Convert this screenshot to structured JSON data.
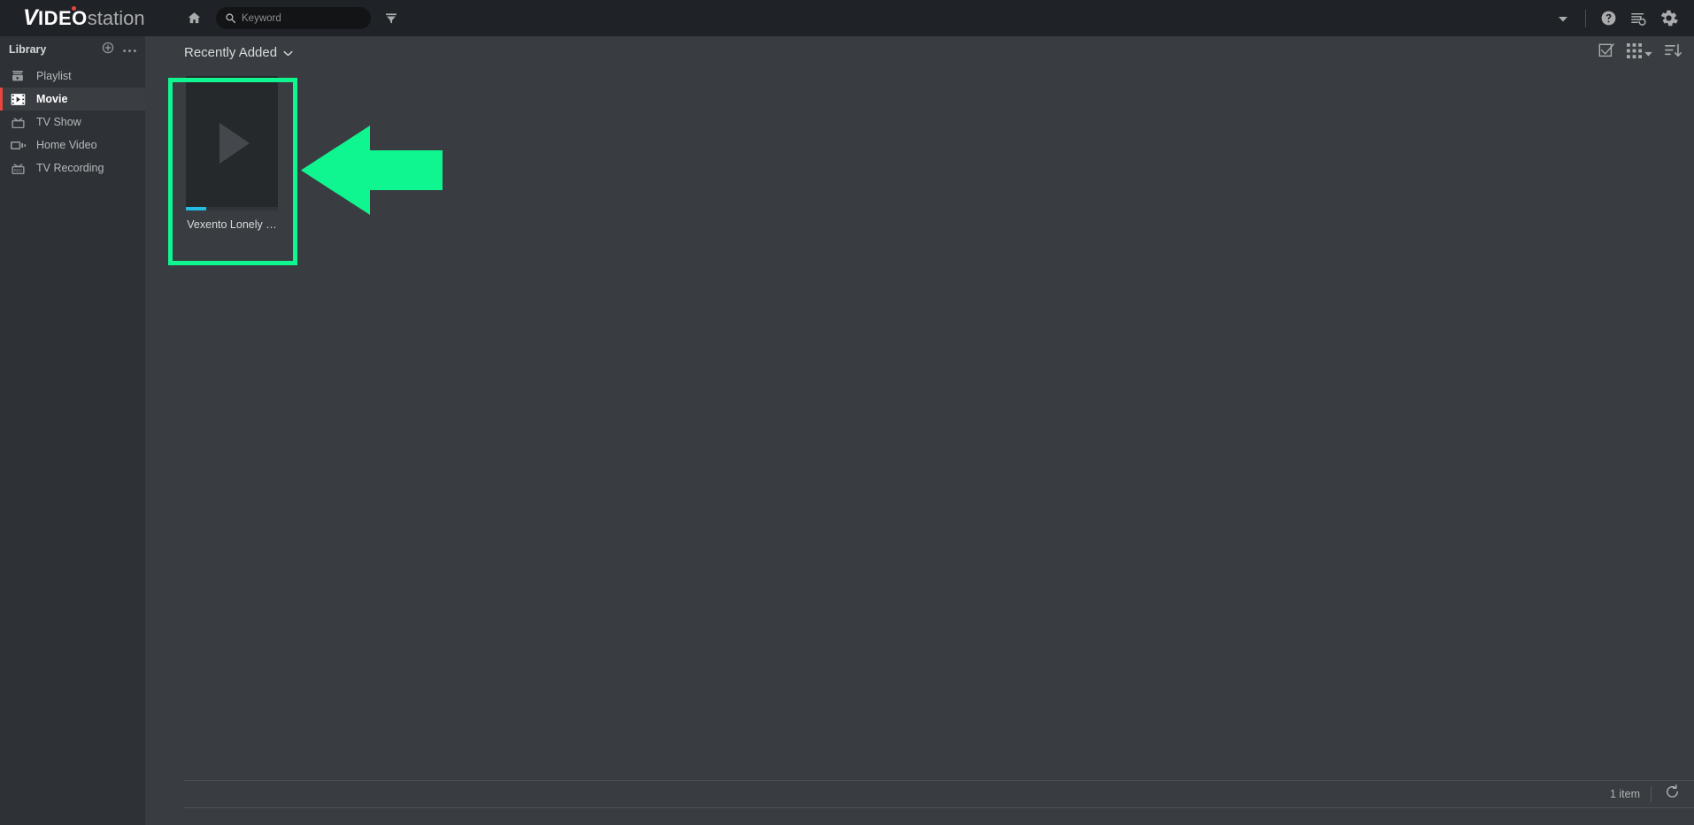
{
  "app": {
    "logo_primary": "V",
    "logo_bold": "IDEO",
    "logo_light": "station",
    "accent_red": "#e8453c",
    "accent_cyan": "#23bde3",
    "annotation_green": "#0ff58f"
  },
  "topbar": {
    "home_icon": "home-icon",
    "search": {
      "placeholder": "Keyword",
      "value": "",
      "icon": "search-icon"
    },
    "filter_icon": "filter-icon",
    "chevron_icon": "chevron-down-icon",
    "help_icon": "help-icon",
    "log_icon": "log-history-icon",
    "settings_icon": "gear-icon"
  },
  "sidebar": {
    "title": "Library",
    "add_icon": "plus-circle-icon",
    "more_icon": "ellipsis-icon",
    "items": [
      {
        "label": "Playlist",
        "icon": "playlist-icon",
        "active": false
      },
      {
        "label": "Movie",
        "icon": "film-strip-icon",
        "active": true
      },
      {
        "label": "TV Show",
        "icon": "tv-icon",
        "active": false
      },
      {
        "label": "Home Video",
        "icon": "camcorder-icon",
        "active": false
      },
      {
        "label": "TV Recording",
        "icon": "tv-rec-icon",
        "active": false
      }
    ]
  },
  "main": {
    "sort_label": "Recently Added",
    "sort_chevron_icon": "chevron-down-icon",
    "select_icon": "checkbox-check-icon",
    "view_icon": "grid-view-icon",
    "view_chevron_icon": "chevron-down-icon",
    "sort_order_icon": "sort-descending-icon",
    "cards": [
      {
        "title": "Vexento Lonely …",
        "play_icon": "play-icon",
        "progress_percent": 22
      }
    ]
  },
  "footer": {
    "item_count": "1 item",
    "refresh_icon": "refresh-icon"
  },
  "annotations": {
    "highlight_box": "highlight-rectangle",
    "arrow": "left-pointing-arrow"
  }
}
